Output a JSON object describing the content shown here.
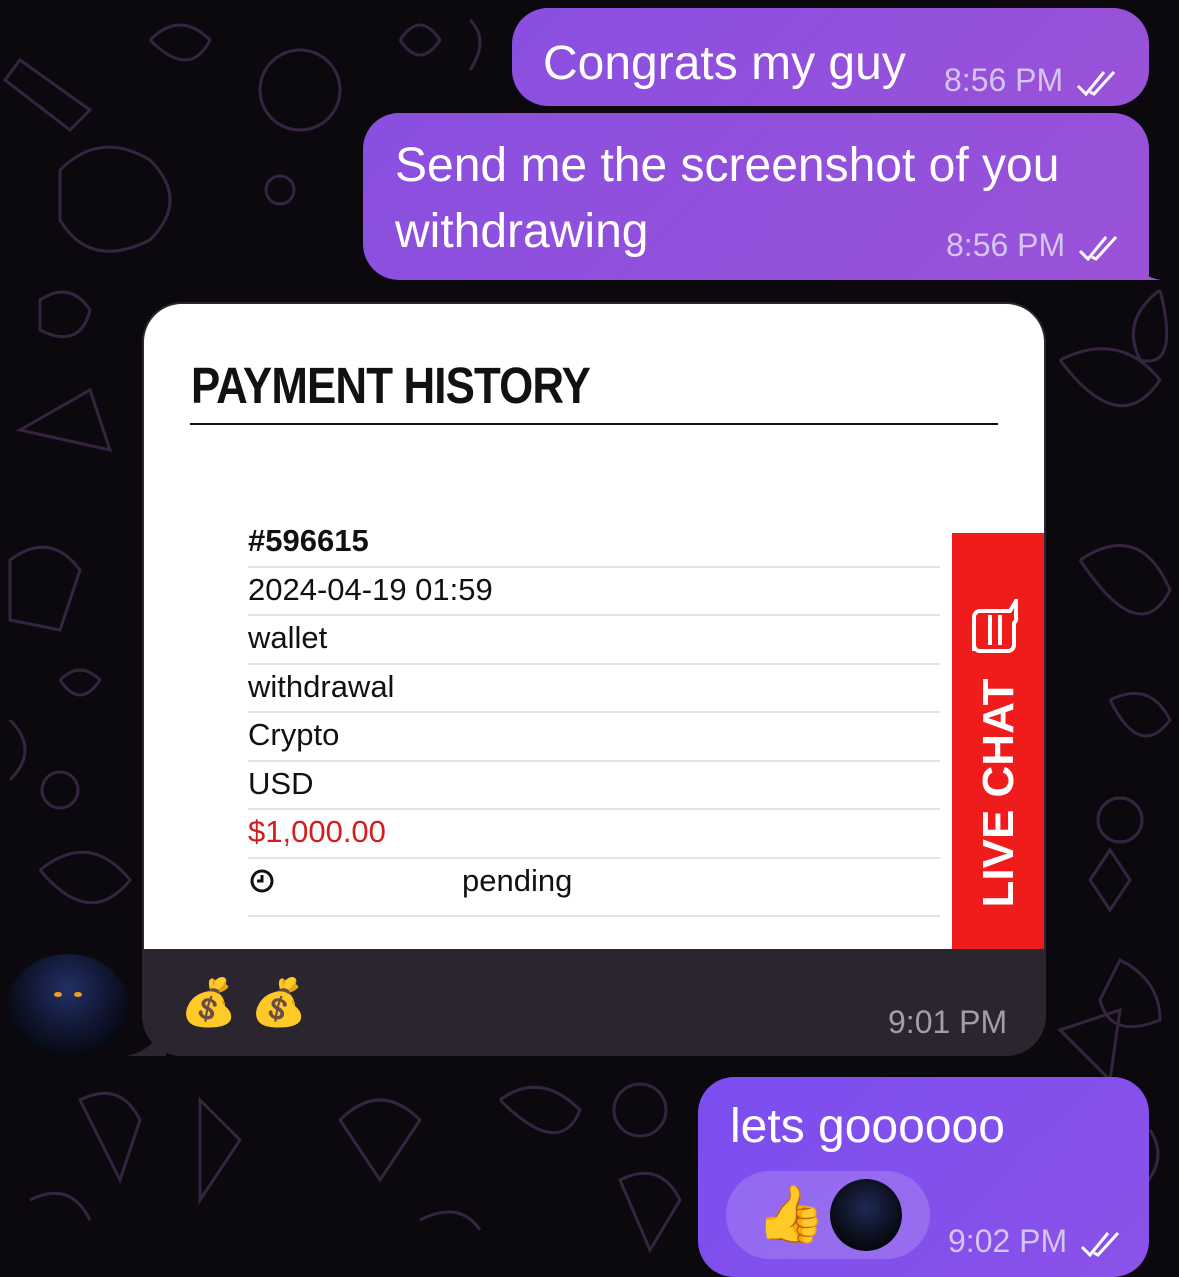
{
  "messages": {
    "m1": {
      "text": "Congrats my guy",
      "time": "8:56 PM",
      "read_icon": "double-check-icon"
    },
    "m2": {
      "text": "Send me the screenshot of you withdrawing",
      "time": "8:56 PM",
      "read_icon": "double-check-icon"
    },
    "incoming": {
      "screenshot": {
        "title": "PAYMENT HISTORY",
        "rows": [
          "#596615",
          "2024-04-19 01:59",
          "wallet",
          "withdrawal",
          "Crypto",
          "USD",
          "$1,000.00"
        ],
        "status_icon": "clock-icon",
        "status": "pending",
        "live_chat_label": "LIVE CHAT",
        "amount_color": "#d11f1f"
      },
      "caption": "💰 💰",
      "time": "9:01 PM"
    },
    "m3": {
      "text": "lets goooooo",
      "time": "9:02 PM",
      "reaction": "👍",
      "read_icon": "double-check-icon"
    }
  },
  "colors": {
    "outgoing_bubble": "#8a4fe0",
    "incoming_bubble": "#2b2530",
    "background": "#0b090d",
    "live_chat": "#f01c1c"
  }
}
